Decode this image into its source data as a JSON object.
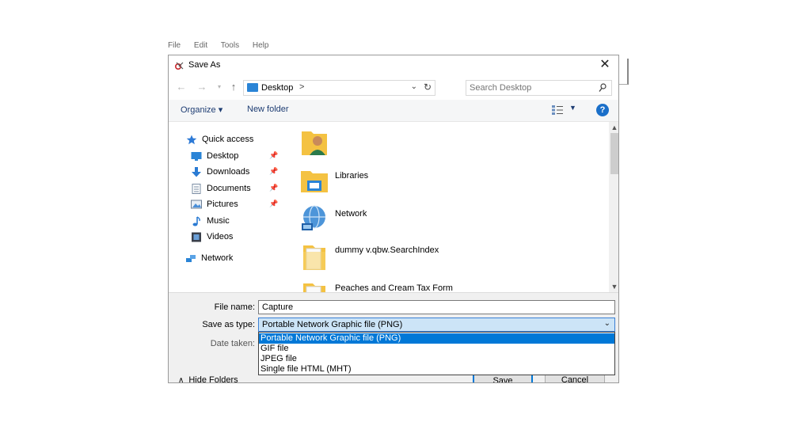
{
  "background_app": {
    "menu": [
      "File",
      "Edit",
      "Tools",
      "Help"
    ]
  },
  "dialog": {
    "title": "Save As",
    "close_label": "✕"
  },
  "navigation": {
    "address_text": "Desktop",
    "address_chevron": ">",
    "search_placeholder": "Search Desktop"
  },
  "toolbar": {
    "organize_label": "Organize ▾",
    "new_folder_label": "New folder",
    "help_label": "?"
  },
  "nav_pane": {
    "quick_access": "Quick access",
    "items": [
      {
        "label": "Desktop",
        "icon": "desktop-icon",
        "pinned": true
      },
      {
        "label": "Downloads",
        "icon": "downloads-icon",
        "pinned": true
      },
      {
        "label": "Documents",
        "icon": "documents-icon",
        "pinned": true
      },
      {
        "label": "Pictures",
        "icon": "pictures-icon",
        "pinned": true
      },
      {
        "label": "Music",
        "icon": "music-icon",
        "pinned": false
      },
      {
        "label": "Videos",
        "icon": "videos-icon",
        "pinned": false
      }
    ],
    "network": "Network"
  },
  "files": [
    {
      "name": "",
      "icon": "user-folder-icon"
    },
    {
      "name": "Libraries",
      "icon": "libraries-icon"
    },
    {
      "name": "Network",
      "icon": "network-globe-icon"
    },
    {
      "name": "dummy v.qbw.SearchIndex",
      "icon": "folder-icon"
    },
    {
      "name": "Peaches and Cream Tax Form",
      "icon": "folder-icon"
    }
  ],
  "form": {
    "file_name_label": "File name:",
    "file_name_value": "Capture",
    "save_type_label": "Save as type:",
    "save_type_value": "Portable Network Graphic file (PNG)",
    "date_taken_label": "Date taken:",
    "type_options": [
      "Portable Network Graphic file (PNG)",
      "GIF file",
      "JPEG file",
      "Single file HTML (MHT)"
    ],
    "selected_option_index": 0
  },
  "footer": {
    "hide_folders_label": "Hide Folders",
    "save_label": "Save",
    "cancel_label": "Cancel"
  },
  "colors": {
    "accent": "#0078d7",
    "link_text": "#1e3d73",
    "folder_yellow": "#f4c242"
  }
}
